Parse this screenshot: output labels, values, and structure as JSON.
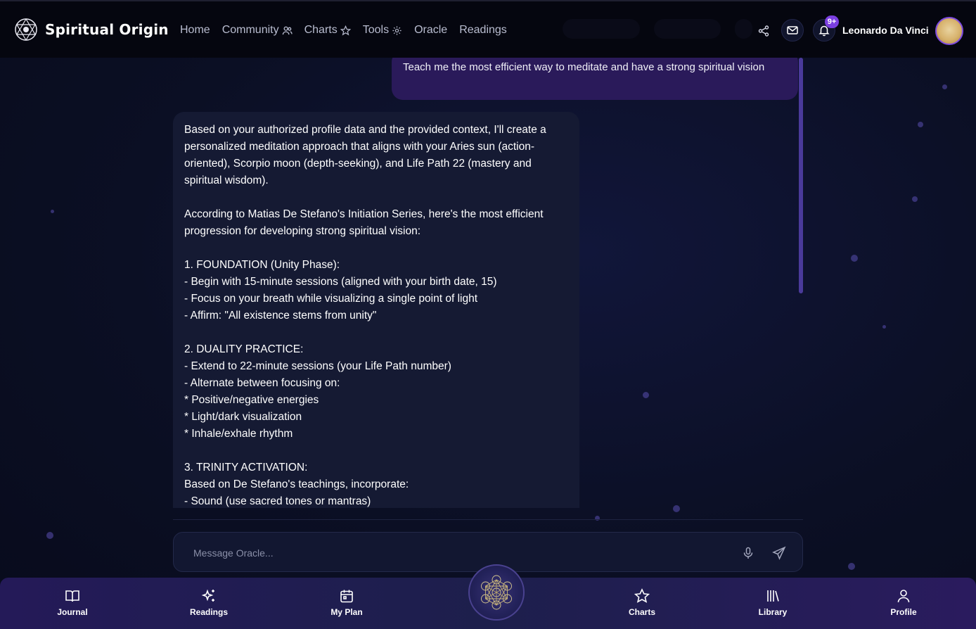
{
  "app": {
    "brand": "Spiritual Origin"
  },
  "nav": {
    "home": "Home",
    "community": "Community",
    "charts": "Charts",
    "tools": "Tools",
    "oracle": "Oracle",
    "readings": "Readings"
  },
  "header": {
    "username": "Leonardo Da Vinci",
    "notifications_badge": "9+",
    "icons": [
      "share-icon",
      "mail-icon",
      "bell-icon"
    ]
  },
  "chat": {
    "user_message": "Teach me the most efficient way to meditate and have a strong spiritual vision",
    "bot_message": "Based on your authorized profile data and the provided context, I'll create a personalized meditation approach that aligns with your Aries sun (action-oriented), Scorpio moon (depth-seeking), and Life Path 22 (mastery and spiritual wisdom).\n\nAccording to Matias De Stefano's Initiation Series, here's the most efficient progression for developing strong spiritual vision:\n\n1. FOUNDATION (Unity Phase):\n- Begin with 15-minute sessions (aligned with your birth date, 15)\n- Focus on your breath while visualizing a single point of light\n- Affirm: \"All existence stems from unity\"\n\n2. DUALITY PRACTICE:\n- Extend to 22-minute sessions (your Life Path number)\n- Alternate between focusing on:\n* Positive/negative energies\n* Light/dark visualization\n* Inhale/exhale rhythm\n\n3. TRINITY ACTIVATION:\nBased on De Stefano's teachings, incorporate:\n- Sound (use sacred tones or mantras)"
  },
  "composer": {
    "placeholder": "Message Oracle..."
  },
  "bottom_nav": {
    "journal": "Journal",
    "readings": "Readings",
    "my_plan": "My Plan",
    "charts": "Charts",
    "library": "Library",
    "profile": "Profile"
  },
  "colors": {
    "accent": "#7b3fe0",
    "user_bubble": "#2a1a5a",
    "bot_bubble": "#151a33"
  }
}
